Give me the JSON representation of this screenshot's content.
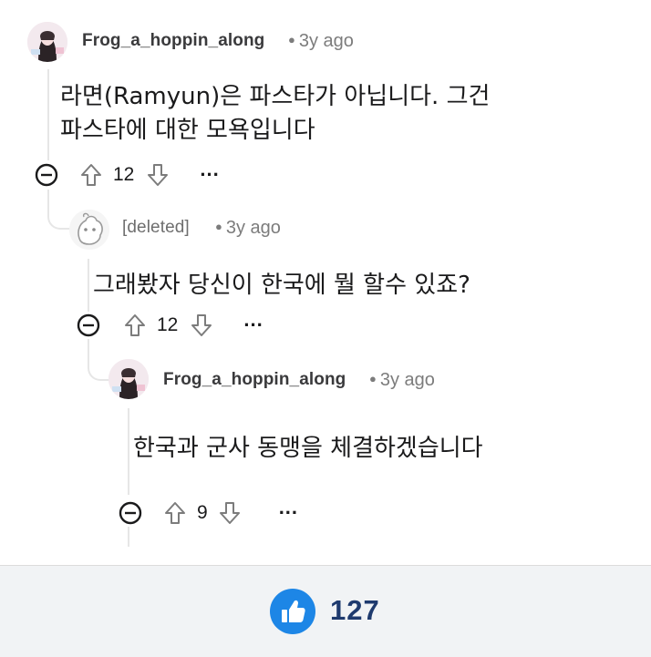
{
  "comments": [
    {
      "username": "Frog_a_hoppin_along",
      "time": "3y ago",
      "body_lines": [
        "라면(Ramyun)은 파스타가 아닙니다. 그건",
        "파스타에 대한 모욕입니다"
      ],
      "score": "12",
      "more": "..."
    },
    {
      "username": "[deleted]",
      "time": "3y ago",
      "body_lines": [
        "그래봤자 당신이 한국에 뭘 할수 있죠?"
      ],
      "score": "12",
      "more": "..."
    },
    {
      "username": "Frog_a_hoppin_along",
      "time": "3y ago",
      "body_lines": [
        "한국과 군사 동맹을 체결하겠습니다"
      ],
      "score": "9",
      "more": "..."
    }
  ],
  "footer": {
    "like_count": "127",
    "like_icon": "thumbs-up-icon",
    "accent": "#1d86e6"
  },
  "colors": {
    "text": "#1a1a1b",
    "meta": "#7c7c7c",
    "thread_line": "#e6e6e6",
    "footer_bg": "#f1f3f5",
    "count": "#1e3a6e"
  }
}
